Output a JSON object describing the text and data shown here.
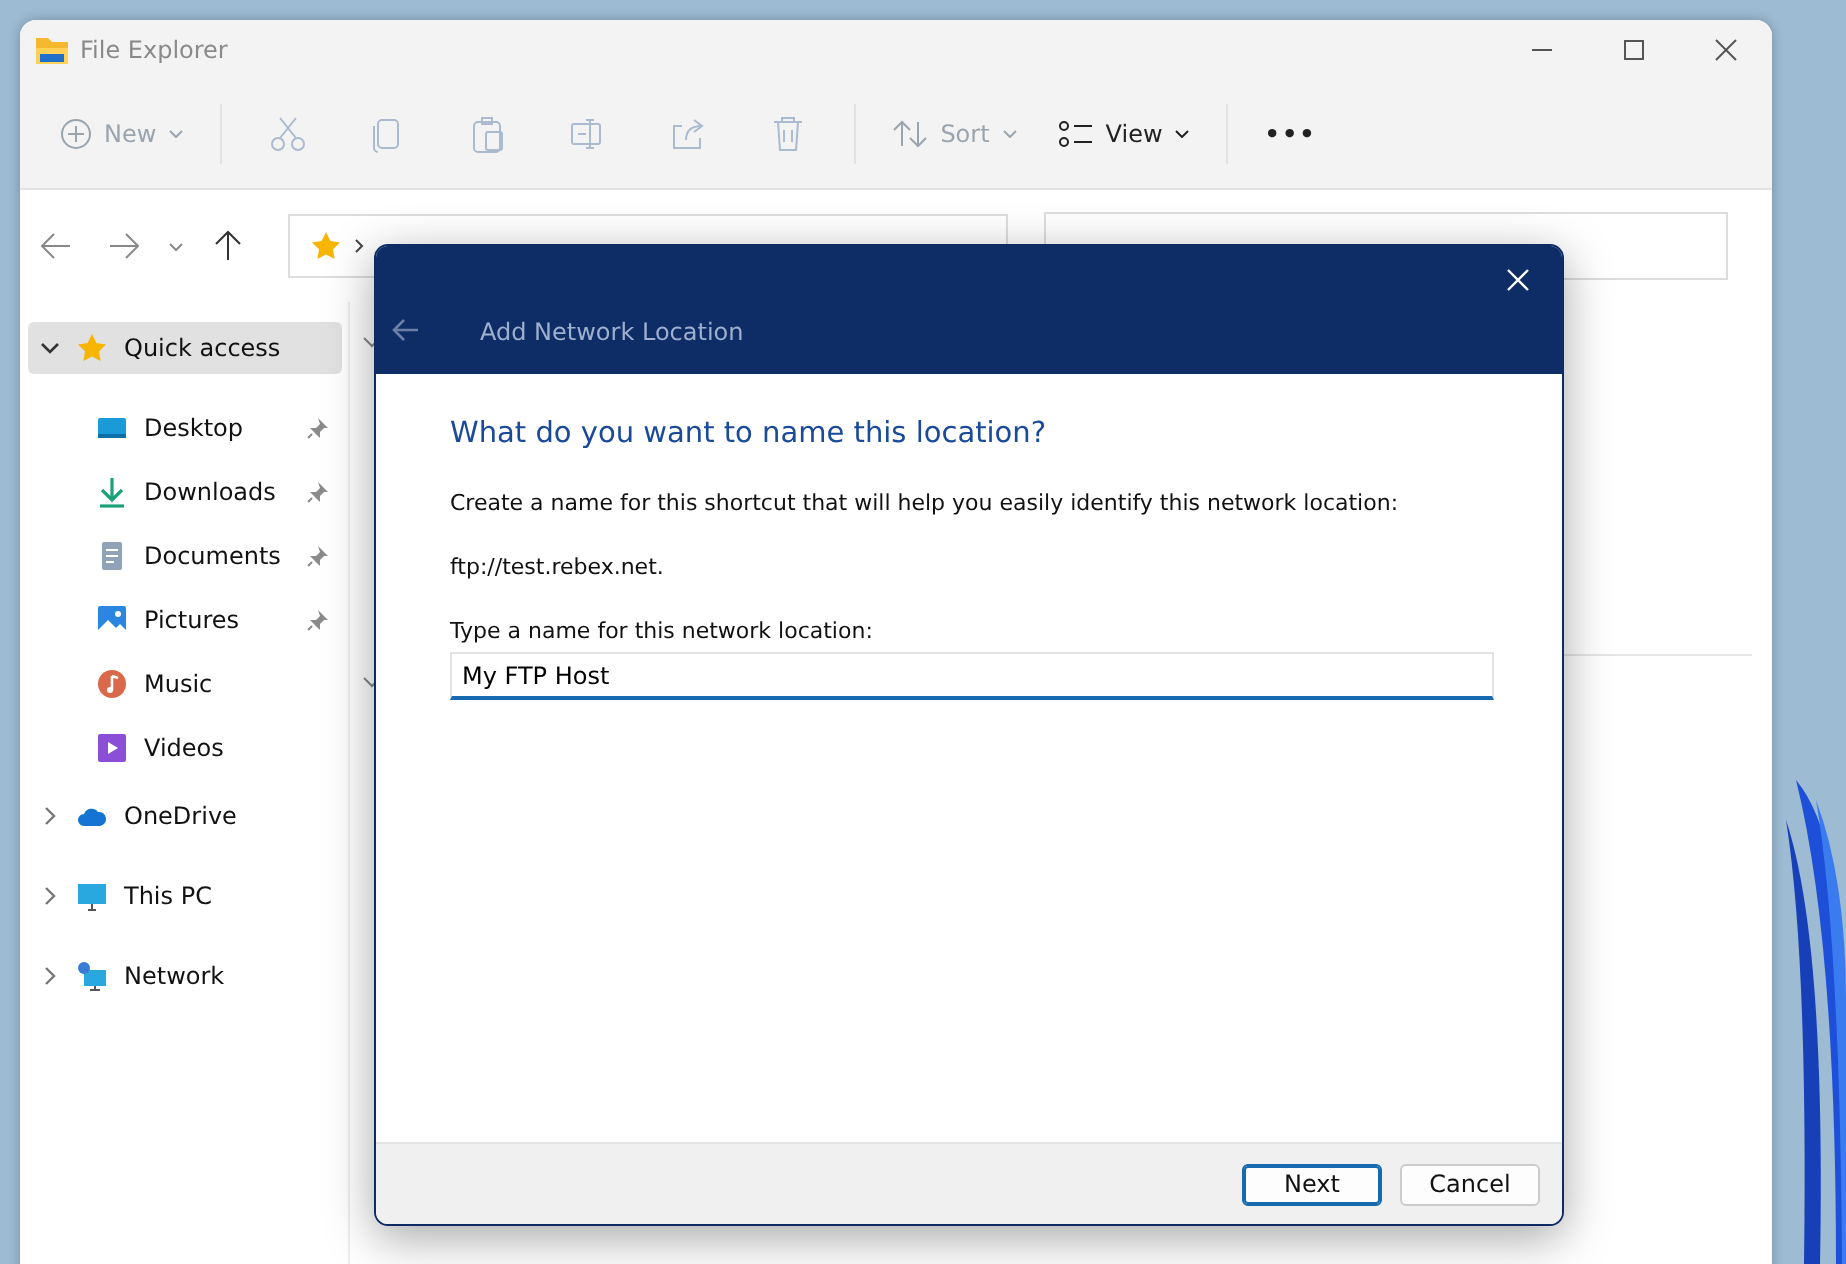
{
  "window": {
    "title": "File Explorer"
  },
  "toolbar": [
    {
      "kind": "new",
      "label": "New",
      "disabled": true
    },
    {
      "kind": "cut",
      "disabled": true
    },
    {
      "kind": "copy",
      "disabled": true
    },
    {
      "kind": "paste",
      "disabled": true
    },
    {
      "kind": "rename",
      "disabled": true
    },
    {
      "kind": "share",
      "disabled": true
    },
    {
      "kind": "delete",
      "disabled": true
    },
    {
      "kind": "sort",
      "label": "Sort",
      "disabled": true
    },
    {
      "kind": "view",
      "label": "View",
      "disabled": false
    },
    {
      "kind": "more",
      "label": "•••",
      "disabled": false
    }
  ],
  "sidebar": {
    "items": [
      {
        "label": "Quick access",
        "kind": "star",
        "selected": true,
        "expanded": true,
        "children": [
          {
            "label": "Desktop",
            "kind": "desktop",
            "pinned": true
          },
          {
            "label": "Downloads",
            "kind": "download",
            "pinned": true
          },
          {
            "label": "Documents",
            "kind": "document",
            "pinned": true
          },
          {
            "label": "Pictures",
            "kind": "pictures",
            "pinned": true
          },
          {
            "label": "Music",
            "kind": "music",
            "pinned": false
          },
          {
            "label": "Videos",
            "kind": "videos",
            "pinned": false
          }
        ]
      },
      {
        "label": "OneDrive",
        "kind": "cloud",
        "selected": false,
        "expanded": false
      },
      {
        "label": "This PC",
        "kind": "pc",
        "selected": false,
        "expanded": false
      },
      {
        "label": "Network",
        "kind": "network",
        "selected": false,
        "expanded": false
      }
    ]
  },
  "dialog": {
    "title": "Add Network Location",
    "heading": "What do you want to name this location?",
    "description": "Create a name for this shortcut that will help you easily identify this network location:",
    "address": "ftp://test.rebex.net.",
    "field_label": "Type a name for this network location:",
    "value": "My FTP Host",
    "buttons": [
      {
        "label": "Next",
        "default": true
      },
      {
        "label": "Cancel",
        "default": false
      }
    ]
  }
}
